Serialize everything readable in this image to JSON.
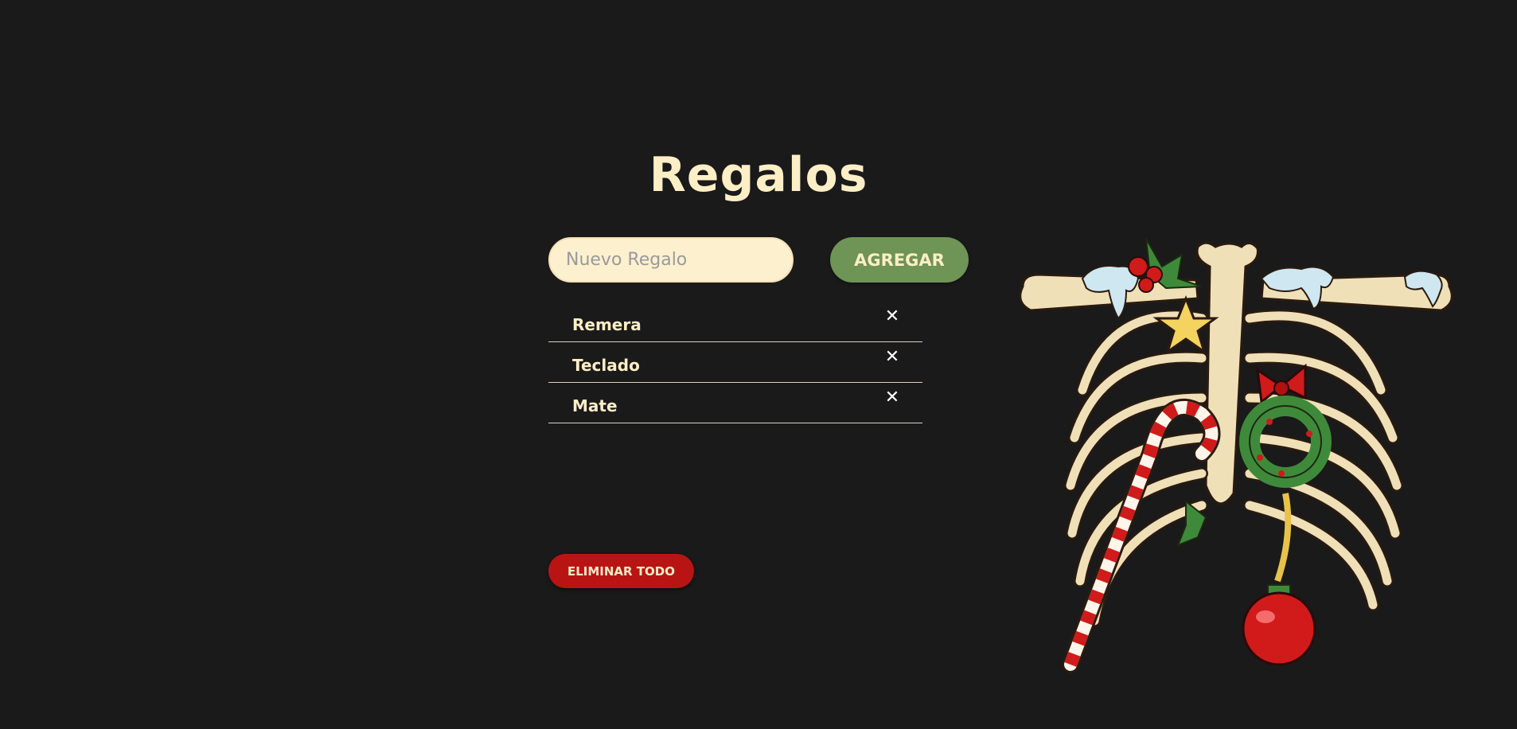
{
  "header": {
    "title": "Regalos"
  },
  "form": {
    "input_placeholder": "Nuevo Regalo",
    "input_value": "",
    "add_label": "AGREGAR"
  },
  "gifts": [
    {
      "name": "Remera",
      "remove_symbol": "✕"
    },
    {
      "name": "Teclado",
      "remove_symbol": "✕"
    },
    {
      "name": "Mate",
      "remove_symbol": "✕"
    }
  ],
  "actions": {
    "clear_label": "ELIMINAR TODO"
  },
  "illustration": {
    "icon": "christmas-ribcage-illustration"
  },
  "colors": {
    "background": "#1a1a1a",
    "title": "#fdeec6",
    "input_bg": "#fdf0cf",
    "add_button": "#6e9456",
    "clear_button": "#b91414",
    "divider": "#d9d2c0"
  }
}
